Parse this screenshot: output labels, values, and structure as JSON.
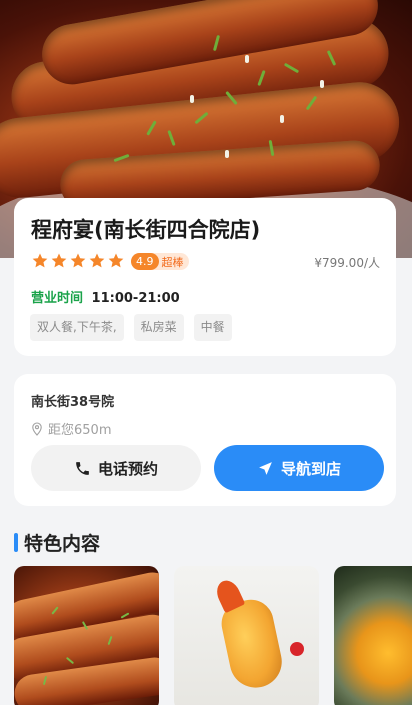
{
  "restaurant": {
    "name": "程府宴(南长街四合院店)",
    "rating_stars": 5,
    "score": "4.9",
    "score_tag": "超棒",
    "price": "¥799.00/人",
    "hours_label": "营业时间",
    "hours_value": "11:00-21:00",
    "tags": [
      "双人餐,下午茶,",
      "私房菜",
      "中餐"
    ]
  },
  "address": {
    "street": "南长街38号院",
    "distance": "距您650m",
    "call_label": "电话预约",
    "nav_label": "导航到店"
  },
  "featured": {
    "title": "特色内容"
  },
  "colors": {
    "accent": "#2a8cf7",
    "star": "#f5862a",
    "open": "#1aa34a"
  }
}
